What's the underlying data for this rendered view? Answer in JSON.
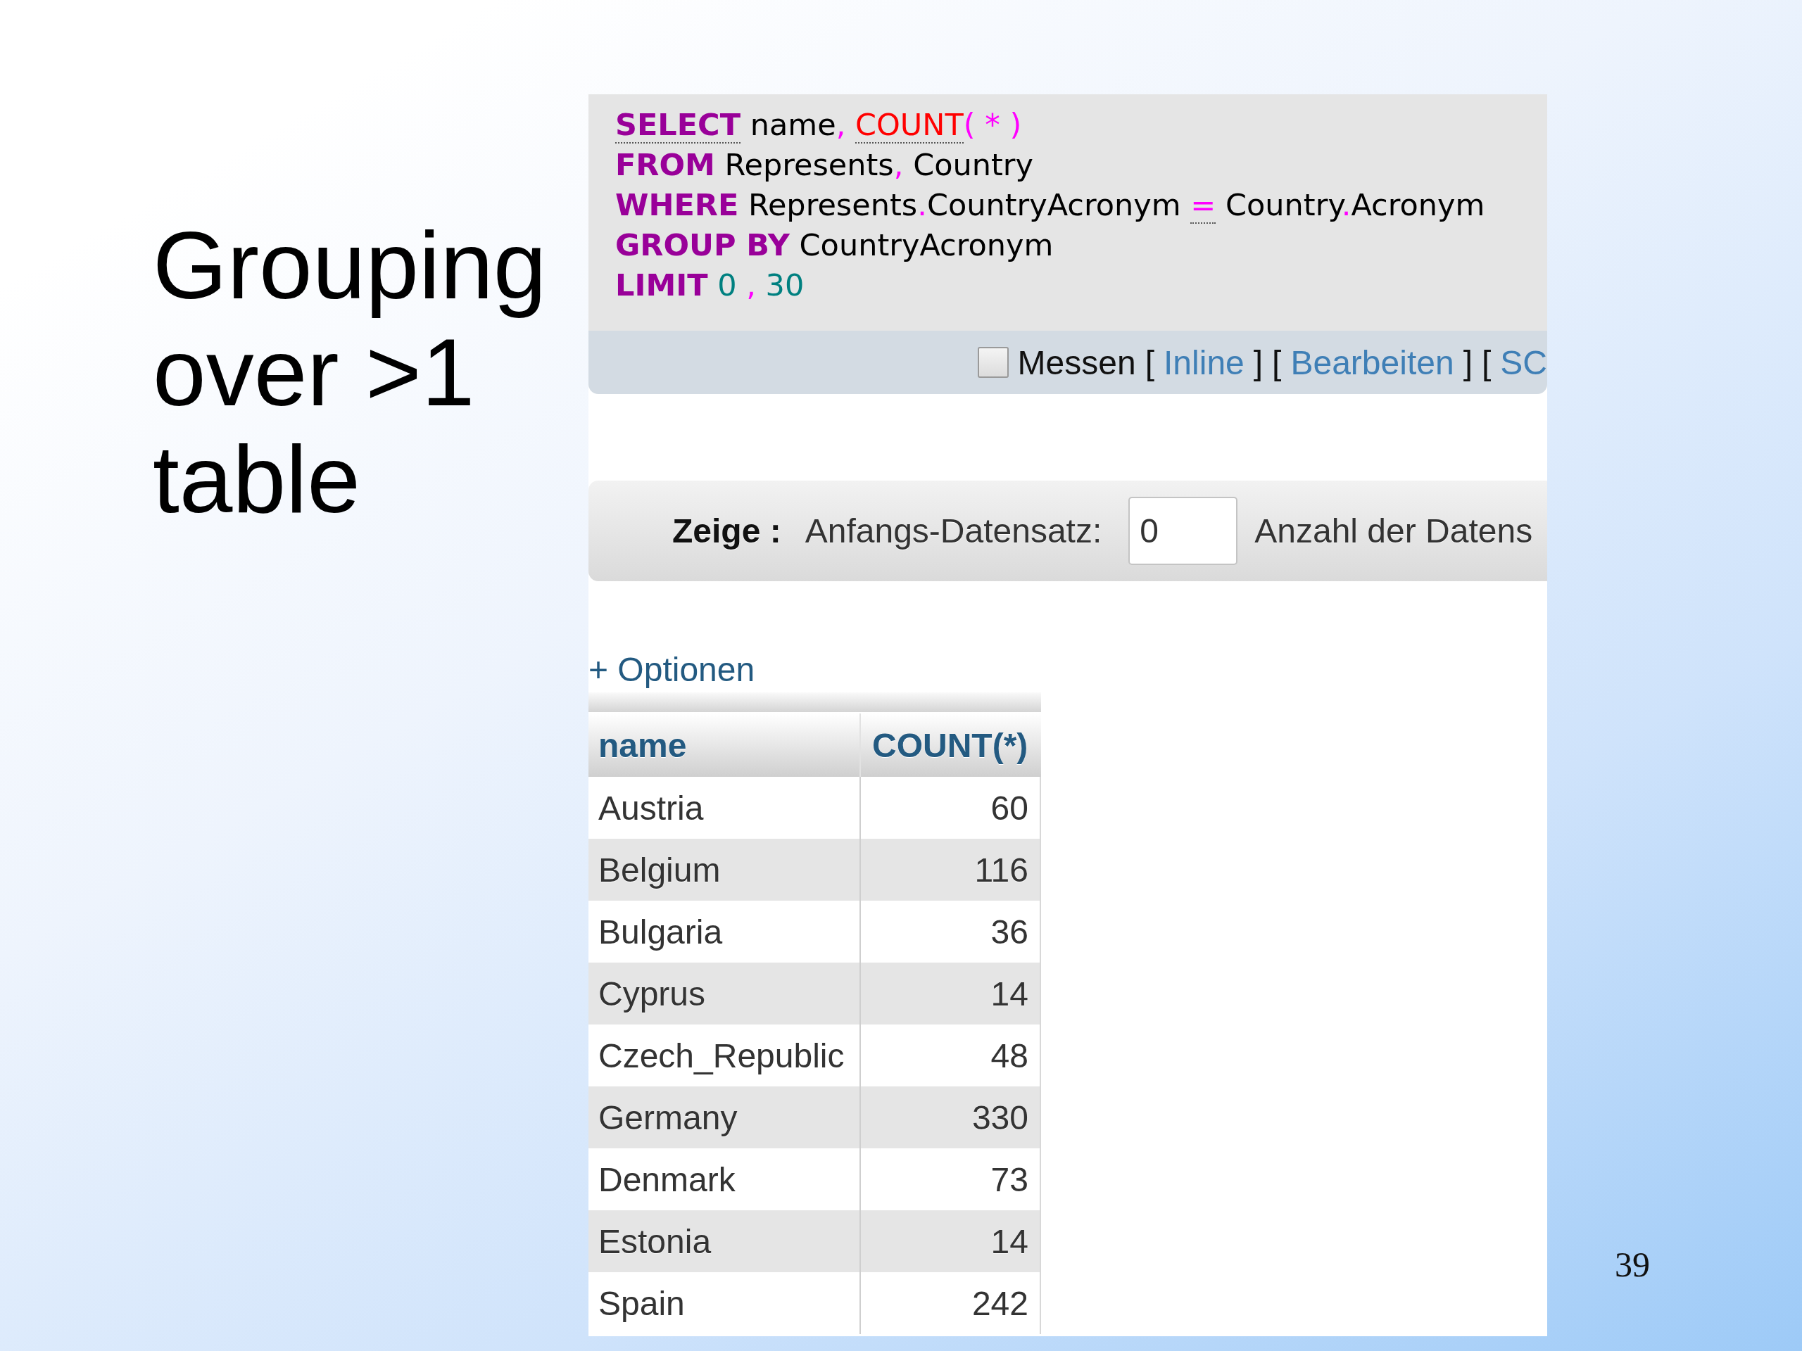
{
  "slide": {
    "title": "Grouping over >1 table",
    "number": "39"
  },
  "sql": {
    "lines": [
      {
        "tokens": [
          {
            "kind": "keyword",
            "text": "SELECT",
            "underlined": true
          },
          {
            "kind": "plain",
            "text": " name",
            "underlined": false
          },
          {
            "kind": "punct",
            "text": ", ",
            "underlined": false
          },
          {
            "kind": "function",
            "text": "COUNT",
            "underlined": true
          },
          {
            "kind": "punct",
            "text": "( * )",
            "underlined": false
          }
        ]
      },
      {
        "tokens": [
          {
            "kind": "keyword",
            "text": "FROM",
            "underlined": false
          },
          {
            "kind": "plain",
            "text": " Represents",
            "underlined": false
          },
          {
            "kind": "punct",
            "text": ", ",
            "underlined": false
          },
          {
            "kind": "plain",
            "text": "Country",
            "underlined": false
          }
        ]
      },
      {
        "tokens": [
          {
            "kind": "keyword",
            "text": "WHERE",
            "underlined": false
          },
          {
            "kind": "plain",
            "text": " Represents",
            "underlined": false
          },
          {
            "kind": "punct",
            "text": ".",
            "underlined": false
          },
          {
            "kind": "plain",
            "text": "CountryAcronym ",
            "underlined": false
          },
          {
            "kind": "punct",
            "text": "=",
            "underlined": true
          },
          {
            "kind": "plain",
            "text": " Country",
            "underlined": false
          },
          {
            "kind": "punct",
            "text": ".",
            "underlined": false
          },
          {
            "kind": "plain",
            "text": "Acronym",
            "underlined": false
          }
        ]
      },
      {
        "tokens": [
          {
            "kind": "keyword",
            "text": "GROUP BY",
            "underlined": false
          },
          {
            "kind": "plain",
            "text": " CountryAcronym",
            "underlined": false
          }
        ]
      },
      {
        "tokens": [
          {
            "kind": "keyword",
            "text": "LIMIT",
            "underlined": false
          },
          {
            "kind": "number",
            "text": " 0 ",
            "underlined": false
          },
          {
            "kind": "punct",
            "text": ",",
            "underlined": false
          },
          {
            "kind": "number",
            "text": " 30",
            "underlined": false
          }
        ]
      }
    ]
  },
  "toolbar": {
    "measure": {
      "label": "Messen",
      "checked": false
    },
    "links": [
      {
        "open": "[",
        "text": "Inline",
        "close": "]"
      },
      {
        "open": "[",
        "text": "Bearbeiten",
        "close": "]"
      },
      {
        "open": "[",
        "text": "SC"
      }
    ]
  },
  "navigation": {
    "title": "Zeige :",
    "start_label": "Anfangs-Datensatz:",
    "start_value": "0",
    "count_label": "Anzahl der Datens"
  },
  "options_link": "+ Optionen",
  "table": {
    "columns": [
      {
        "label": "name",
        "kind": "text"
      },
      {
        "label": "COUNT(*)",
        "kind": "number"
      }
    ],
    "rows": [
      {
        "cells": [
          "Austria",
          "60"
        ]
      },
      {
        "cells": [
          "Belgium",
          "116"
        ]
      },
      {
        "cells": [
          "Bulgaria",
          "36"
        ]
      },
      {
        "cells": [
          "Cyprus",
          "14"
        ]
      },
      {
        "cells": [
          "Czech_Republic",
          "48"
        ]
      },
      {
        "cells": [
          "Germany",
          "330"
        ]
      },
      {
        "cells": [
          "Denmark",
          "73"
        ]
      },
      {
        "cells": [
          "Estonia",
          "14"
        ]
      },
      {
        "cells": [
          "Spain",
          "242"
        ]
      }
    ]
  }
}
